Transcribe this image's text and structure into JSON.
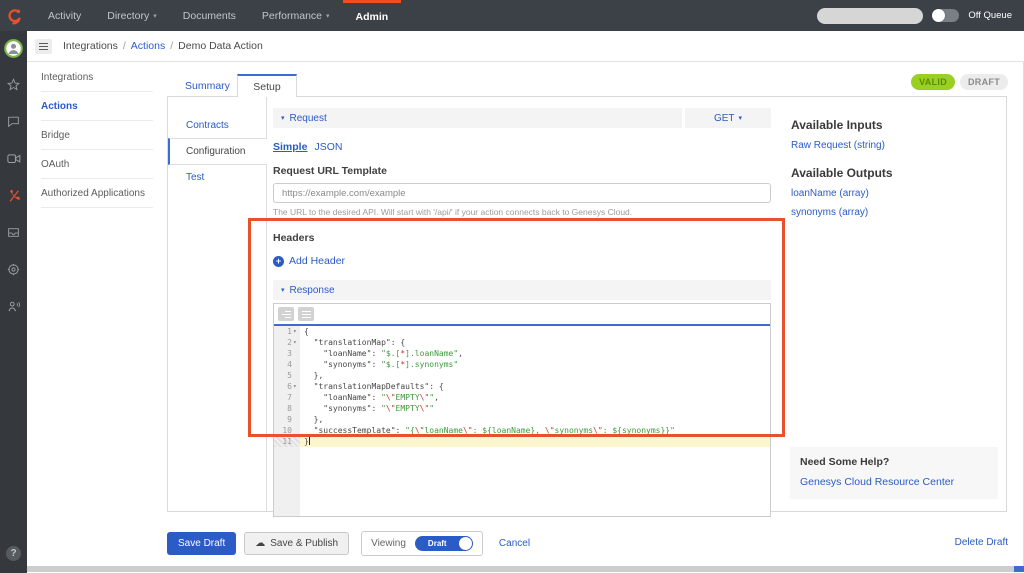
{
  "topbar": {
    "nav": [
      {
        "label": "Activity"
      },
      {
        "label": "Directory"
      },
      {
        "label": "Documents"
      },
      {
        "label": "Performance"
      },
      {
        "label": "Admin"
      }
    ],
    "caret": "▾",
    "off_queue_label": "Off Queue"
  },
  "breadcrumb": {
    "root": "Integrations",
    "sep": "/",
    "section": "Actions",
    "current": "Demo Data Action"
  },
  "sidebar": {
    "items": [
      "Integrations",
      "Actions",
      "Bridge",
      "OAuth",
      "Authorized Applications"
    ]
  },
  "tabs": {
    "summary": "Summary",
    "setup": "Setup"
  },
  "status": {
    "valid": "VALID",
    "draft": "DRAFT"
  },
  "subtabs": {
    "contracts": "Contracts",
    "configuration": "Configuration",
    "test": "Test"
  },
  "request": {
    "title": "Request",
    "collapse_caret": "▾",
    "method": "GET",
    "method_caret": "▾",
    "mode_simple": "Simple",
    "mode_json": "JSON",
    "url_label": "Request URL Template",
    "url_value": "https://example.com/example",
    "url_help": "The URL to the desired API. Will start with '/api/' if your action connects back to Genesys Cloud.",
    "headers_label": "Headers",
    "add_header_plus": "+",
    "add_header_label": "Add Header"
  },
  "response": {
    "title": "Response",
    "collapse_caret": "▾",
    "code": {
      "lines": [
        {
          "num": 1,
          "fold": true,
          "segs": [
            {
              "c": "p",
              "t": "{"
            }
          ]
        },
        {
          "num": 2,
          "fold": true,
          "segs": [
            {
              "c": "p",
              "t": "  "
            },
            {
              "c": "k",
              "t": "\"translationMap\""
            },
            {
              "c": "p",
              "t": ": {"
            }
          ]
        },
        {
          "num": 3,
          "segs": [
            {
              "c": "p",
              "t": "    "
            },
            {
              "c": "k",
              "t": "\"loanName\""
            },
            {
              "c": "p",
              "t": ": "
            },
            {
              "c": "g",
              "t": "\"$.["
            },
            {
              "c": "r",
              "t": "*"
            },
            {
              "c": "g",
              "t": "].loanName\""
            },
            {
              "c": "p",
              "t": ","
            }
          ]
        },
        {
          "num": 4,
          "segs": [
            {
              "c": "p",
              "t": "    "
            },
            {
              "c": "k",
              "t": "\"synonyms\""
            },
            {
              "c": "p",
              "t": ": "
            },
            {
              "c": "g",
              "t": "\"$.["
            },
            {
              "c": "r",
              "t": "*"
            },
            {
              "c": "g",
              "t": "].synonyms\""
            }
          ]
        },
        {
          "num": 5,
          "segs": [
            {
              "c": "p",
              "t": "  },"
            }
          ]
        },
        {
          "num": 6,
          "fold": true,
          "segs": [
            {
              "c": "p",
              "t": "  "
            },
            {
              "c": "k",
              "t": "\"translationMapDefaults\""
            },
            {
              "c": "p",
              "t": ": {"
            }
          ]
        },
        {
          "num": 7,
          "segs": [
            {
              "c": "p",
              "t": "    "
            },
            {
              "c": "k",
              "t": "\"loanName\""
            },
            {
              "c": "p",
              "t": ": "
            },
            {
              "c": "g",
              "t": "\""
            },
            {
              "c": "r",
              "t": "\\\""
            },
            {
              "c": "g",
              "t": "EMPTY"
            },
            {
              "c": "r",
              "t": "\\\""
            },
            {
              "c": "g",
              "t": "\""
            },
            {
              "c": "p",
              "t": ","
            }
          ]
        },
        {
          "num": 8,
          "segs": [
            {
              "c": "p",
              "t": "    "
            },
            {
              "c": "k",
              "t": "\"synonyms\""
            },
            {
              "c": "p",
              "t": ": "
            },
            {
              "c": "g",
              "t": "\""
            },
            {
              "c": "r",
              "t": "\\\""
            },
            {
              "c": "g",
              "t": "EMPTY"
            },
            {
              "c": "r",
              "t": "\\\""
            },
            {
              "c": "g",
              "t": "\""
            }
          ]
        },
        {
          "num": 9,
          "segs": [
            {
              "c": "p",
              "t": "  },"
            }
          ]
        },
        {
          "num": 10,
          "segs": [
            {
              "c": "p",
              "t": "  "
            },
            {
              "c": "k",
              "t": "\"successTemplate\""
            },
            {
              "c": "p",
              "t": ": "
            },
            {
              "c": "g",
              "t": "\"{"
            },
            {
              "c": "r",
              "t": "\\\""
            },
            {
              "c": "g",
              "t": "loanName"
            },
            {
              "c": "r",
              "t": "\\\""
            },
            {
              "c": "g",
              "t": ": ${loanName}, "
            },
            {
              "c": "r",
              "t": "\\\""
            },
            {
              "c": "g",
              "t": "synonyms"
            },
            {
              "c": "r",
              "t": "\\\""
            },
            {
              "c": "g",
              "t": ": ${synonyms}}\""
            }
          ]
        },
        {
          "num": 11,
          "active": true,
          "cursor": true,
          "segs": [
            {
              "c": "p",
              "t": "}"
            }
          ]
        }
      ]
    }
  },
  "right_panel": {
    "inputs_title": "Available Inputs",
    "inputs": [
      "Raw Request (string)"
    ],
    "outputs_title": "Available Outputs",
    "outputs": [
      "loanName (array)",
      "synonyms (array)"
    ],
    "help_title": "Need Some Help?",
    "help_link": "Genesys Cloud Resource Center"
  },
  "footer": {
    "save_draft": "Save Draft",
    "save_publish": "Save & Publish",
    "viewing_label": "Viewing",
    "viewing_value": "Draft",
    "cancel": "Cancel",
    "delete_draft": "Delete Draft"
  },
  "colors": {
    "accent_blue": "#2a5bc7",
    "brand_orange": "#e8502e",
    "valid_green": "#9ad024",
    "annotation_border": "#e8502e"
  }
}
